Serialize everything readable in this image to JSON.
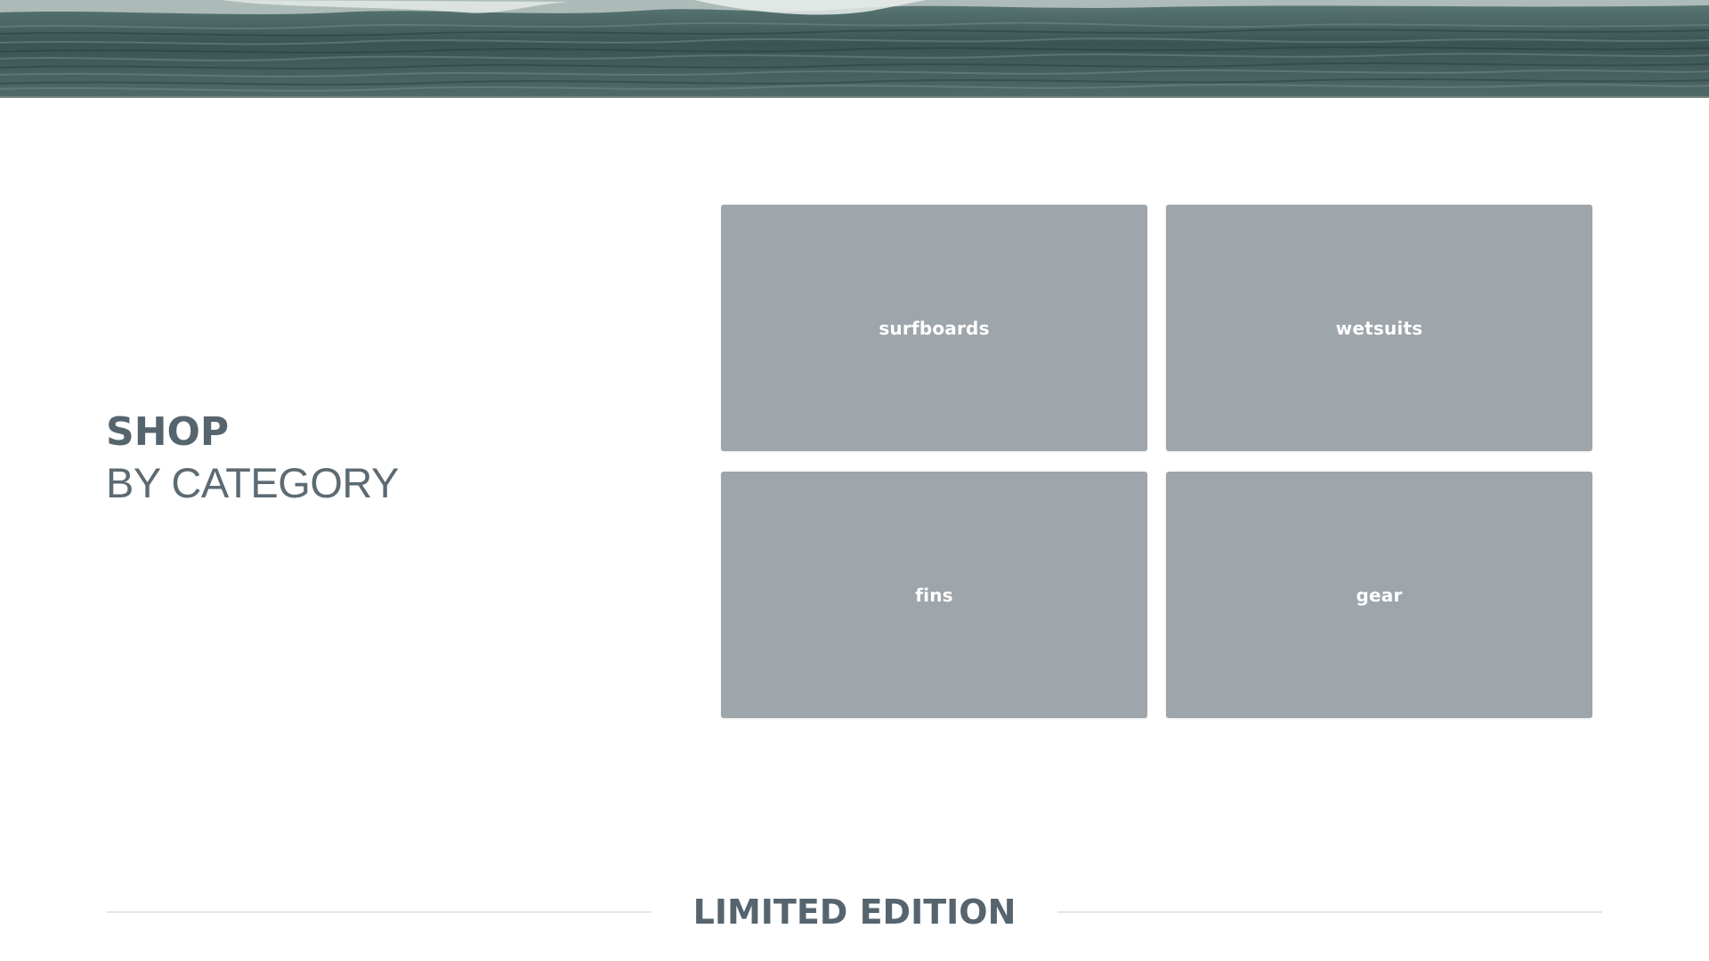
{
  "hero": {
    "image": "ocean-waves-image"
  },
  "heading": {
    "line1": "SHOP",
    "line2": "BY CATEGORY"
  },
  "categories": [
    {
      "label": "surfboards"
    },
    {
      "label": "wetsuits"
    },
    {
      "label": "fins"
    },
    {
      "label": "gear"
    }
  ],
  "section": {
    "title": "LIMITED EDITION"
  },
  "colors": {
    "tile": "#9ea5ab",
    "heading": "#56646e",
    "divider": "#e3e6e8"
  }
}
